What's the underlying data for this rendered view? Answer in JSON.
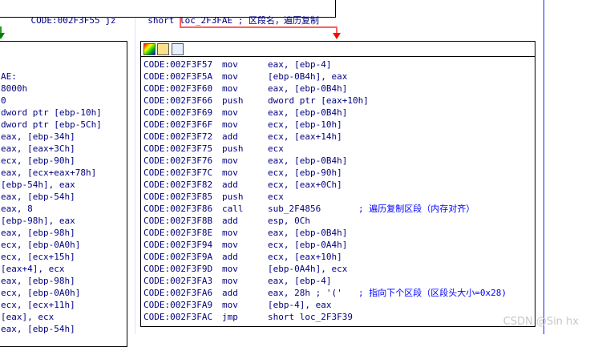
{
  "top_block": {
    "addr": "CODE:002F3F55",
    "mnemonic": "jz",
    "operand": "short loc_2F3FAE ; 区段名，遍历复制"
  },
  "left_block": {
    "lines": [
      "AE:",
      "8000h",
      "0",
      "dword ptr [ebp-10h]",
      "dword ptr [ebp-5Ch]",
      "eax, [ebp-34h]",
      "eax, [eax+3Ch]",
      "ecx, [ebp-90h]",
      "eax, [ecx+eax+78h]",
      "[ebp-54h], eax",
      "eax, [ebp-54h]",
      "eax, 8",
      "[ebp-98h], eax",
      "eax, [ebp-98h]",
      "ecx, [ebp-0A0h]",
      "ecx, [ecx+15h]",
      "[eax+4], ecx",
      "eax, [ebp-98h]",
      "ecx, [ebp-0A0h]",
      "ecx, [ecx+11h]",
      "[eax], ecx",
      "eax, [ebp-54h]"
    ]
  },
  "main_block": {
    "rows": [
      {
        "addr": "CODE:002F3F57",
        "mn": "mov",
        "op": "eax, [ebp-4]",
        "cmt": ""
      },
      {
        "addr": "CODE:002F3F5A",
        "mn": "mov",
        "op": "[ebp-0B4h], eax",
        "cmt": ""
      },
      {
        "addr": "CODE:002F3F60",
        "mn": "mov",
        "op": "eax, [ebp-0B4h]",
        "cmt": ""
      },
      {
        "addr": "CODE:002F3F66",
        "mn": "push",
        "op": "dword ptr [eax+10h]",
        "cmt": ""
      },
      {
        "addr": "CODE:002F3F69",
        "mn": "mov",
        "op": "eax, [ebp-0B4h]",
        "cmt": ""
      },
      {
        "addr": "CODE:002F3F6F",
        "mn": "mov",
        "op": "ecx, [ebp-10h]",
        "cmt": ""
      },
      {
        "addr": "CODE:002F3F72",
        "mn": "add",
        "op": "ecx, [eax+14h]",
        "cmt": ""
      },
      {
        "addr": "CODE:002F3F75",
        "mn": "push",
        "op": "ecx",
        "cmt": ""
      },
      {
        "addr": "CODE:002F3F76",
        "mn": "mov",
        "op": "eax, [ebp-0B4h]",
        "cmt": ""
      },
      {
        "addr": "CODE:002F3F7C",
        "mn": "mov",
        "op": "ecx, [ebp-90h]",
        "cmt": ""
      },
      {
        "addr": "CODE:002F3F82",
        "mn": "add",
        "op": "ecx, [eax+0Ch]",
        "cmt": ""
      },
      {
        "addr": "CODE:002F3F85",
        "mn": "push",
        "op": "ecx",
        "cmt": ""
      },
      {
        "addr": "CODE:002F3F86",
        "mn": "call",
        "op": "sub_2F4856",
        "cmt": "; 遍历复制区段（内存对齐）"
      },
      {
        "addr": "CODE:002F3F8B",
        "mn": "add",
        "op": "esp, 0Ch",
        "cmt": ""
      },
      {
        "addr": "CODE:002F3F8E",
        "mn": "mov",
        "op": "eax, [ebp-0B4h]",
        "cmt": ""
      },
      {
        "addr": "CODE:002F3F94",
        "mn": "mov",
        "op": "ecx, [ebp-0A4h]",
        "cmt": ""
      },
      {
        "addr": "CODE:002F3F9A",
        "mn": "add",
        "op": "ecx, [eax+10h]",
        "cmt": ""
      },
      {
        "addr": "CODE:002F3F9D",
        "mn": "mov",
        "op": "[ebp-0A4h], ecx",
        "cmt": ""
      },
      {
        "addr": "CODE:002F3FA3",
        "mn": "mov",
        "op": "eax, [ebp-4]",
        "cmt": ""
      },
      {
        "addr": "CODE:002F3FA6",
        "mn": "add",
        "op": "eax, 28h ; '('",
        "cmt": "; 指向下个区段（区段头大小=0x28)"
      },
      {
        "addr": "CODE:002F3FA9",
        "mn": "mov",
        "op": "[ebp-4], eax",
        "cmt": ""
      },
      {
        "addr": "CODE:002F3FAC",
        "mn": "jmp",
        "op": "short loc_2F3F39",
        "cmt": ""
      }
    ]
  },
  "watermark": "CSDN @Sin hx",
  "colors": {
    "false_branch": "#ff0000",
    "true_branch": "#008000",
    "loop_back": "#0000ff"
  }
}
